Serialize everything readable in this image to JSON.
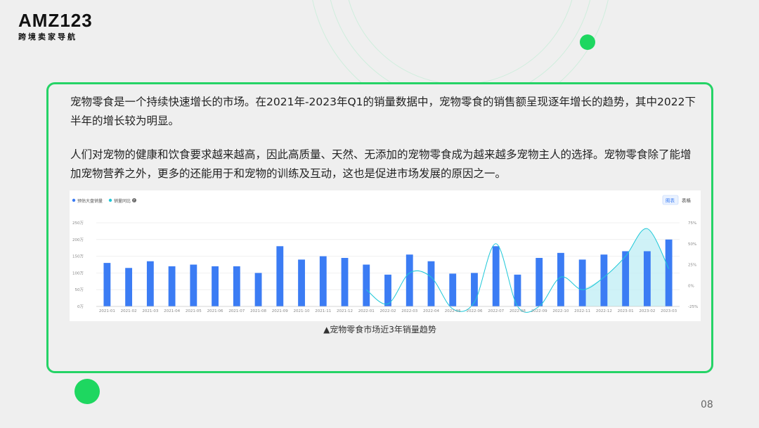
{
  "brand": {
    "name": "AMZ123",
    "tagline": "跨境卖家导航"
  },
  "paragraphs": [
    "宠物零食是一个持续快速增长的市场。在2021年-2023年Q1的销量数据中，宠物零食的销售额呈现逐年增长的趋势，其中2022下半年的增长较为明显。",
    "人们对宠物的健康和饮食要求越来越高，因此高质量、天然、无添加的宠物零食成为越来越多宠物主人的选择。宠物零食除了能增加宠物营养之外，更多的还能用于和宠物的训练及互动，这也是促进市场发展的原因之一。"
  ],
  "caption": "▲宠物零食市场近3年销量趋势",
  "page_number": "08",
  "colors": {
    "accent": "#25d366",
    "bar": "#3b7cf4",
    "line": "#1ec8d8",
    "area": "#bfeef4"
  },
  "chart_data": {
    "type": "bar",
    "legend": [
      {
        "label": "预估大盘销量",
        "color": "#3b7cf4"
      },
      {
        "label": "销量同比",
        "color": "#1ec8d8",
        "icon": "help-icon"
      }
    ],
    "toggle": [
      "图表",
      "表格"
    ],
    "categories": [
      "2021-01",
      "2021-02",
      "2021-03",
      "2021-04",
      "2021-05",
      "2021-06",
      "2021-07",
      "2021-08",
      "2021-09",
      "2021-10",
      "2021-11",
      "2021-12",
      "2022-01",
      "2022-02",
      "2022-03",
      "2022-04",
      "2022-05",
      "2022-06",
      "2022-07",
      "2022-08",
      "2022-09",
      "2022-10",
      "2022-11",
      "2022-12",
      "2023-01",
      "2023-02",
      "2023-03"
    ],
    "series": [
      {
        "name": "预估大盘销量",
        "type": "bar",
        "axis": "left",
        "values": [
          130,
          115,
          135,
          120,
          125,
          120,
          120,
          100,
          180,
          140,
          150,
          145,
          125,
          95,
          155,
          135,
          98,
          100,
          180,
          95,
          145,
          160,
          140,
          155,
          165,
          165,
          200
        ]
      },
      {
        "name": "销量同比",
        "type": "line",
        "axis": "right",
        "start_index": 12,
        "values": [
          -5,
          -22,
          15,
          10,
          -28,
          -20,
          50,
          -25,
          -25,
          10,
          -5,
          10,
          35,
          68,
          20
        ]
      }
    ],
    "y_left": {
      "min": 0,
      "max": 250,
      "ticks": [
        "0万",
        "50万",
        "100万",
        "150万",
        "200万",
        "250万"
      ]
    },
    "y_right": {
      "min": -25,
      "max": 75,
      "ticks": [
        "-25%",
        "0%",
        "25%",
        "50%",
        "75%"
      ]
    },
    "grid": true,
    "legend_position": "top-left"
  }
}
